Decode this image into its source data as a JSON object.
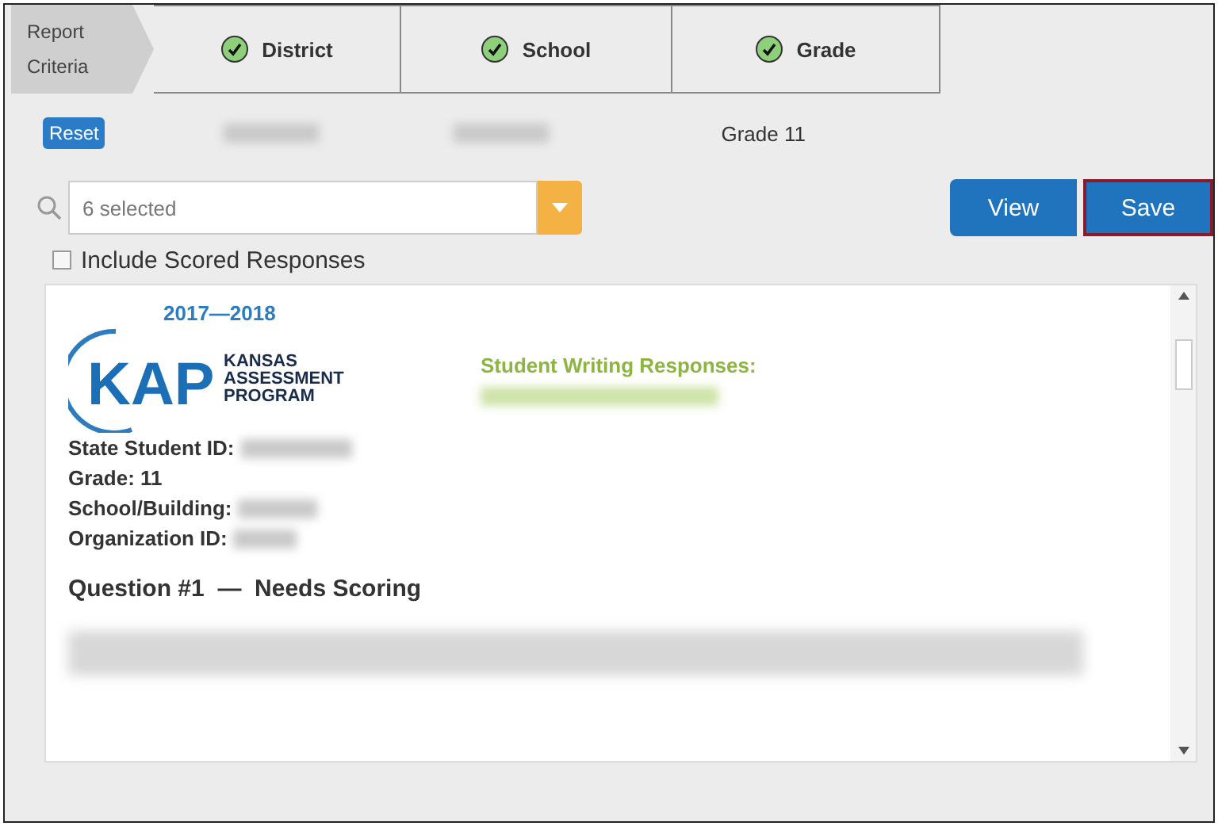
{
  "criteria": {
    "label_line1": "Report",
    "label_line2": "Criteria"
  },
  "steps": [
    {
      "label": "District",
      "done": true,
      "value_redacted": true
    },
    {
      "label": "School",
      "done": true,
      "value_redacted": true
    },
    {
      "label": "Grade",
      "done": true,
      "value": "Grade 11"
    }
  ],
  "reset_button": "Reset",
  "select": {
    "value": "6 selected"
  },
  "buttons": [
    {
      "label": "View",
      "selected": false
    },
    {
      "label": "Save",
      "selected": true
    }
  ],
  "include_scored": {
    "label": "Include Scored Responses",
    "checked": false
  },
  "report": {
    "year": "2017—2018",
    "logo": {
      "mark": "KAP",
      "line1": "KANSAS",
      "line2": "ASSESSMENT",
      "line3": "PROGRAM"
    },
    "heading": "Student Writing Responses:",
    "fields": [
      {
        "label": "State Student ID:",
        "redacted": true
      },
      {
        "label": "Grade: 11",
        "redacted": false
      },
      {
        "label": "School/Building:",
        "redacted": true
      },
      {
        "label": "Organization ID:",
        "redacted": true
      }
    ],
    "question": "Question #1  —  Needs Scoring"
  }
}
